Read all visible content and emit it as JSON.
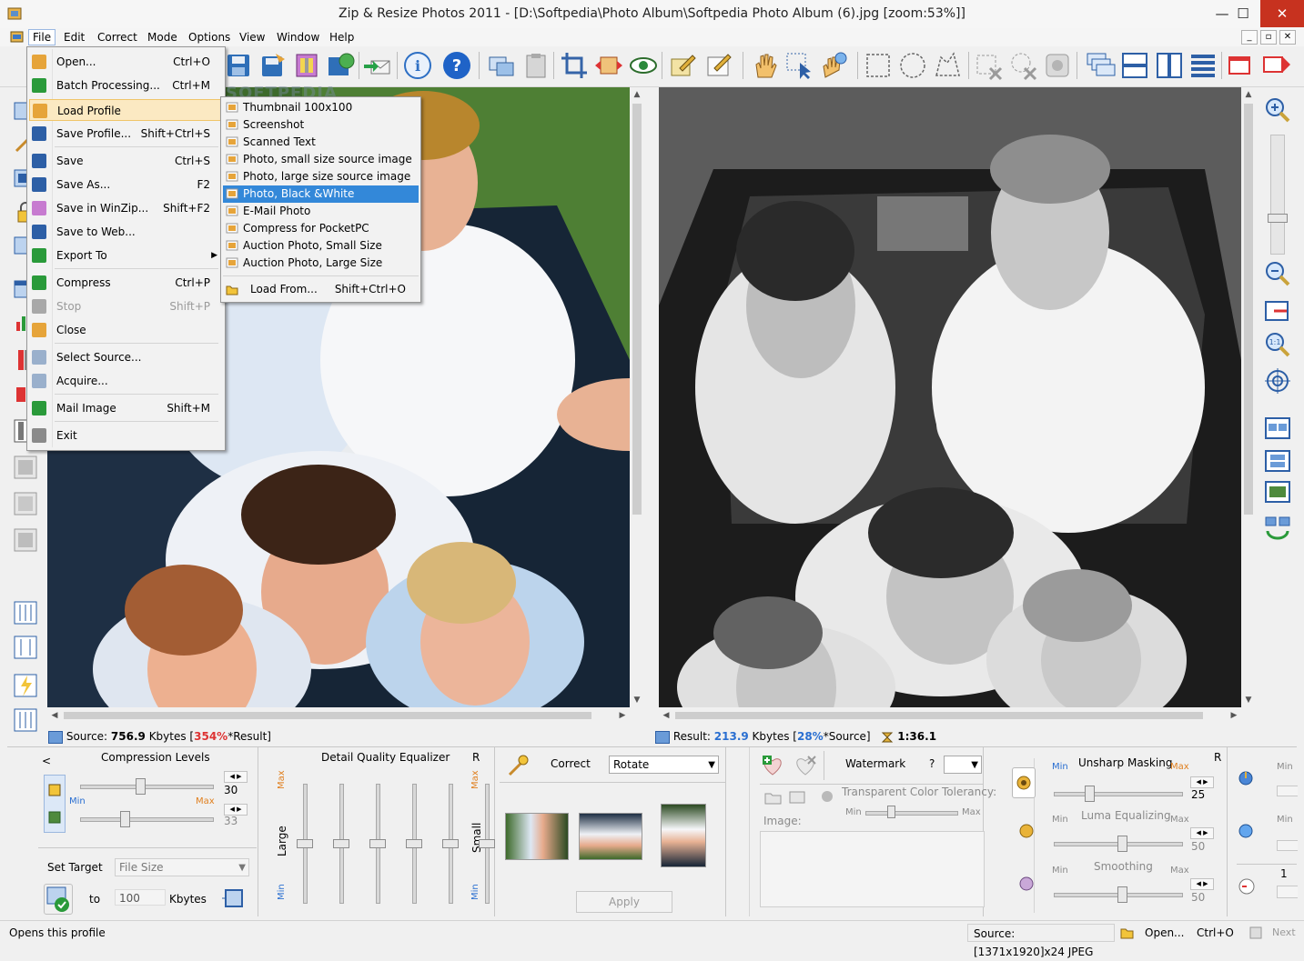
{
  "window": {
    "title": "Zip & Resize Photos 2011 - [D:\\Softpedia\\Photo Album\\Softpedia Photo Album (6).jpg  [zoom:53%]]",
    "minimize": "—",
    "maximize": "☐",
    "close": "✕"
  },
  "menubar": [
    "File",
    "Edit",
    "Correct",
    "Mode",
    "Options",
    "View",
    "Window",
    "Help"
  ],
  "mdi_buttons": [
    "_",
    "▫",
    "✕"
  ],
  "file_menu": [
    {
      "label": "Open...",
      "shortcut": "Ctrl+O"
    },
    {
      "label": "Batch Processing...",
      "shortcut": "Ctrl+M"
    },
    {
      "label": "Load Profile",
      "shortcut": ""
    },
    {
      "label": "Save Profile...",
      "shortcut": "Shift+Ctrl+S"
    },
    {
      "label": "Save",
      "shortcut": "Ctrl+S"
    },
    {
      "label": "Save As...",
      "shortcut": "F2"
    },
    {
      "label": "Save in WinZip...",
      "shortcut": "Shift+F2"
    },
    {
      "label": "Save to Web...",
      "shortcut": ""
    },
    {
      "label": "Export To",
      "shortcut": ""
    },
    {
      "label": "Compress",
      "shortcut": "Ctrl+P"
    },
    {
      "label": "Stop",
      "shortcut": "Shift+P"
    },
    {
      "label": "Close",
      "shortcut": ""
    },
    {
      "label": "Select Source...",
      "shortcut": ""
    },
    {
      "label": "Acquire...",
      "shortcut": ""
    },
    {
      "label": "Mail Image",
      "shortcut": "Shift+M"
    },
    {
      "label": "Exit",
      "shortcut": ""
    }
  ],
  "profile_submenu": [
    "Thumbnail 100x100",
    "Screenshot",
    "Scanned Text",
    "Photo, small size source image",
    "Photo, large size source image",
    "Photo, Black &White",
    "E-Mail Photo",
    "Compress for PocketPC",
    "Auction Photo, Small Size",
    "Auction Photo, Large Size"
  ],
  "profile_load_from": {
    "label": "Load From...",
    "shortcut": "Shift+Ctrl+O"
  },
  "source_info": {
    "prefix": "Source: ",
    "size": "756.9",
    "unit": " Kbytes  [",
    "percent": "354%",
    "suffix": "*Result]"
  },
  "result_info": {
    "prefix": "Result: ",
    "size": "213.9",
    "unit": " Kbytes  [",
    "percent": "28%",
    "suffix": "*Source]",
    "ratio": "1:36.1"
  },
  "compression": {
    "title": "Compression Levels",
    "collapse": "<",
    "min": "Min",
    "max": "Max",
    "level1": "30",
    "level2": "33",
    "level1_fraction": 0.45,
    "level2_fraction": 0.33,
    "set_target": "Set Target",
    "target_select": "File Size",
    "to": "to",
    "target_value": "100",
    "kbytes": "Kbytes"
  },
  "equalizer": {
    "title": "Detail Quality Equalizer",
    "r": "R",
    "max": "Max",
    "min": "Min",
    "large": "Large",
    "small": "Small",
    "bands": [
      0.5,
      0.5,
      0.5,
      0.5,
      0.5,
      0.5
    ]
  },
  "correct": {
    "label": "Correct",
    "select": "Rotate",
    "apply": "Apply"
  },
  "watermark": {
    "label": "Watermark",
    "question": "?",
    "transparent": "Transparent Color Tolerancy:",
    "min": "Min",
    "max": "Max",
    "image_label": "Image:"
  },
  "sharpen": {
    "unsharp": "Unsharp Masking",
    "r": "R",
    "min": "Min",
    "max": "Max",
    "unsharp_value": "25",
    "luma": "Luma Equalizing",
    "luma_value": "50",
    "smoothing": "Smoothing",
    "smoothing_value": "50",
    "right_min1": "Min",
    "right_min2": "Min",
    "right_value": "1"
  },
  "statusbar": {
    "hint": "Opens this profile",
    "source": "Source: [1371x1920]x24 JPEG",
    "open": "Open...",
    "open_shortcut": "Ctrl+O",
    "next": "Next"
  },
  "watermark_logo": "SOFTPEDIA",
  "colors": {
    "menu_highlight": "#fbe9c2",
    "submenu_highlight": "#3388d9",
    "close_button": "#c7321f",
    "accent_blue": "#2a6fd1"
  }
}
